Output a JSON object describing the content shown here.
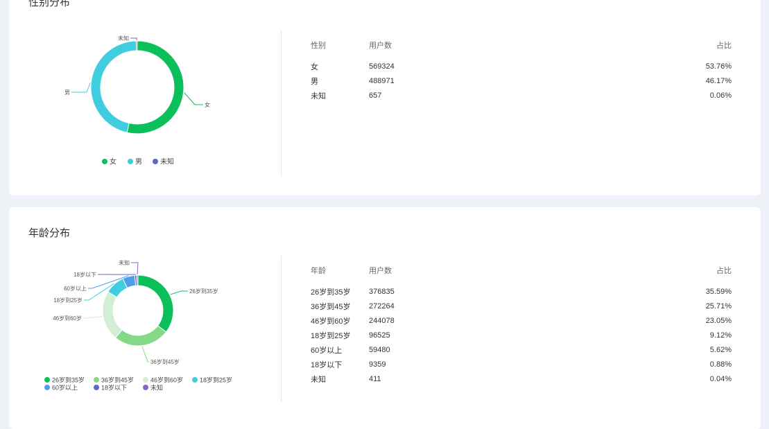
{
  "colors": {
    "page_bg": "#eef2f8",
    "card_bg": "#ffffff",
    "female": "#0bbf5b",
    "male": "#40cde0",
    "unknown": "#5c68c9",
    "age_26_35": "#0bbf5b",
    "age_36_45": "#86d889",
    "age_46_60": "#d2efd4",
    "age_18_25": "#40cde0",
    "age_60_plus": "#4f9ee8",
    "age_under_18": "#5c68c9",
    "age_unknown": "#8a63d2"
  },
  "gender": {
    "title": "性别分布",
    "headers": [
      "性别",
      "用户数",
      "占比"
    ],
    "rows": [
      {
        "label": "女",
        "count": "569324",
        "pct": "53.76%"
      },
      {
        "label": "男",
        "count": "488971",
        "pct": "46.17%"
      },
      {
        "label": "未知",
        "count": "657",
        "pct": "0.06%"
      }
    ]
  },
  "age": {
    "title": "年龄分布",
    "headers": [
      "年龄",
      "用户数",
      "占比"
    ],
    "rows": [
      {
        "label": "26岁到35岁",
        "count": "376835",
        "pct": "35.59%"
      },
      {
        "label": "36岁到45岁",
        "count": "272264",
        "pct": "25.71%"
      },
      {
        "label": "46岁到60岁",
        "count": "244078",
        "pct": "23.05%"
      },
      {
        "label": "18岁到25岁",
        "count": "96525",
        "pct": "9.12%"
      },
      {
        "label": "60岁以上",
        "count": "59480",
        "pct": "5.62%"
      },
      {
        "label": "18岁以下",
        "count": "9359",
        "pct": "0.88%"
      },
      {
        "label": "未知",
        "count": "411",
        "pct": "0.04%"
      }
    ]
  },
  "chart_data": [
    {
      "type": "pie",
      "title": "性别分布",
      "categories": [
        "女",
        "男",
        "未知"
      ],
      "values": [
        569324,
        488971,
        657
      ],
      "legend": [
        "女",
        "男",
        "未知"
      ],
      "legend_position": "bottom",
      "colors": [
        "#0bbf5b",
        "#40cde0",
        "#5c68c9"
      ]
    },
    {
      "type": "pie",
      "title": "年龄分布",
      "categories": [
        "26岁到35岁",
        "36岁到45岁",
        "46岁到60岁",
        "18岁到25岁",
        "60岁以上",
        "18岁以下",
        "未知"
      ],
      "values": [
        376835,
        272264,
        244078,
        96525,
        59480,
        9359,
        411
      ],
      "legend": [
        "26岁到35岁",
        "36岁到45岁",
        "46岁到60岁",
        "18岁到25岁",
        "60岁以上",
        "18岁以下",
        "未知"
      ],
      "legend_position": "bottom",
      "colors": [
        "#0bbf5b",
        "#86d889",
        "#d2efd4",
        "#40cde0",
        "#4f9ee8",
        "#5c68c9",
        "#8a63d2"
      ]
    }
  ]
}
